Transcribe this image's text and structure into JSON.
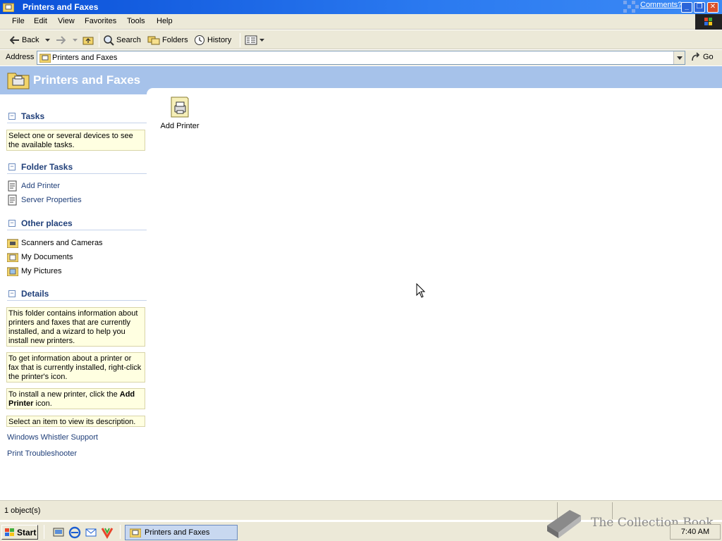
{
  "window": {
    "title": "Printers and Faxes",
    "comments_link": "Comments?"
  },
  "menubar": {
    "items": [
      "File",
      "Edit",
      "View",
      "Favorites",
      "Tools",
      "Help"
    ]
  },
  "toolbar": {
    "back": "Back",
    "search": "Search",
    "folders": "Folders",
    "history": "History"
  },
  "address": {
    "label": "Address",
    "value": "Printers and Faxes",
    "go": "Go"
  },
  "header": {
    "title": "Printers and Faxes"
  },
  "left_pane": {
    "tasks": {
      "title": "Tasks",
      "info": "Select one or several devices to see the available tasks."
    },
    "folder_tasks": {
      "title": "Folder Tasks",
      "items": [
        "Add Printer",
        "Server Properties"
      ]
    },
    "other_places": {
      "title": "Other places",
      "items": [
        "Scanners and Cameras",
        "My Documents",
        "My Pictures"
      ]
    },
    "details": {
      "title": "Details",
      "info1": "This folder contains information about printers and faxes that are currently installed, and a wizard to help you install new printers.",
      "info2": "To get information about a printer or fax that is currently installed, right-click the printer's icon.",
      "info3_pre": "To install a new printer, click the ",
      "info3_bold": "Add Printer",
      "info3_post": " icon.",
      "info4": "Select an item to view its description."
    },
    "links": [
      "Windows Whistler Support",
      "Print Troubleshooter"
    ]
  },
  "content": {
    "items": [
      {
        "label": "Add Printer"
      }
    ]
  },
  "statusbar": {
    "text": "1 object(s)"
  },
  "taskbar": {
    "start": "Start",
    "active_window": "Printers and Faxes",
    "clock": "7:40 AM"
  },
  "watermark": {
    "text": "The Collection Book"
  }
}
